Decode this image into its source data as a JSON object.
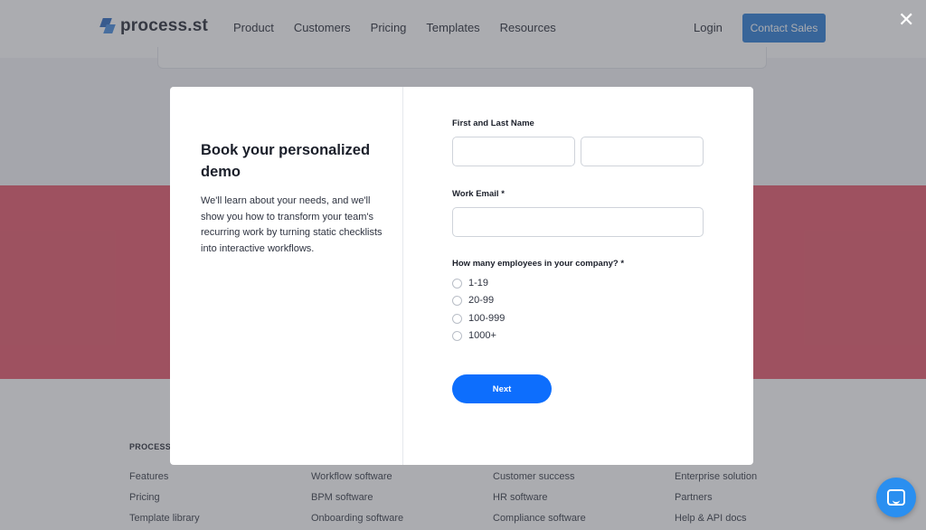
{
  "header": {
    "logo_text": "process.st",
    "nav": [
      "Product",
      "Customers",
      "Pricing",
      "Templates",
      "Resources"
    ],
    "login": "Login",
    "contact_sales": "Contact Sales"
  },
  "footer": {
    "brand": "PROCESS.",
    "columns": [
      [
        "Features",
        "Pricing",
        "Template library"
      ],
      [
        "Workflow software",
        "BPM software",
        "Onboarding software"
      ],
      [
        "Customer success",
        "HR software",
        "Compliance software"
      ],
      [
        "Enterprise solution",
        "Partners",
        "Help & API docs"
      ]
    ]
  },
  "modal": {
    "title": "Book your personalized demo",
    "description": "We'll learn about your needs, and we'll show you how to transform your team's recurring work by turning static checklists into interactive workflows.",
    "name_label": "First and Last Name",
    "first_name_value": "",
    "last_name_value": "",
    "email_label": "Work Email *",
    "email_value": "",
    "employees_label": "How many employees in your company? *",
    "employee_options": [
      "1-19",
      "20-99",
      "100-999",
      "1000+"
    ],
    "next_label": "Next"
  },
  "close_icon": "close-icon",
  "chat_icon": "chat-icon",
  "colors": {
    "accent_blue": "#0d6efd",
    "contact_button": "#2f7fd6",
    "red_band": "#e75a6e",
    "chat_bubble": "#2a8ff0"
  }
}
